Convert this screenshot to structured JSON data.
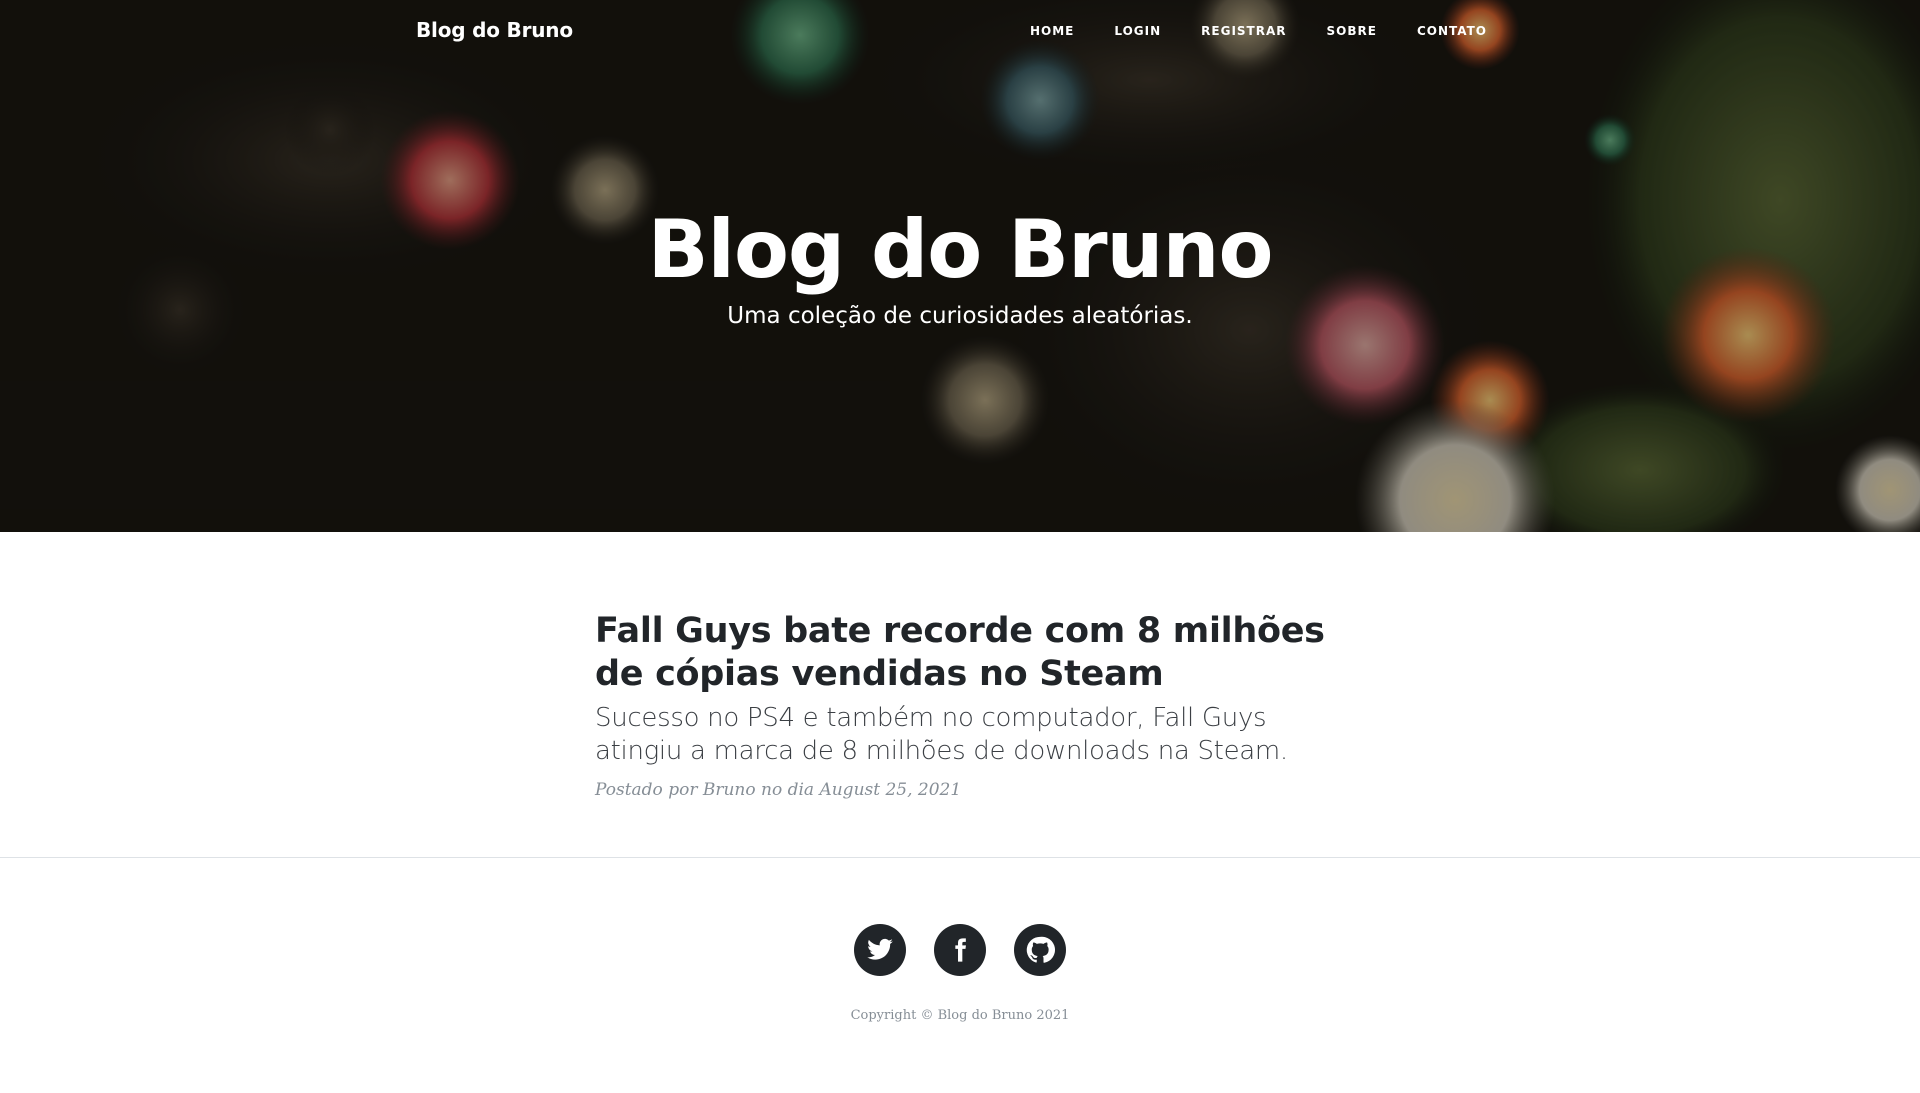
{
  "navbar": {
    "brand": "Blog do Bruno",
    "links": [
      "HOME",
      "LOGIN",
      "REGISTRAR",
      "SOBRE",
      "CONTATO"
    ]
  },
  "hero": {
    "title": "Blog do Bruno",
    "subtitle": "Uma coleção de curiosidades aleatórias."
  },
  "post": {
    "title": "Fall Guys bate recorde com 8 milhões de cópias vendidas no Steam",
    "subtitle": "Sucesso no PS4 e também no computador, Fall Guys atingiu a marca de 8 milhões de downloads na Steam.",
    "meta_prefix": "Postado por ",
    "author": "Bruno",
    "meta_date": " no dia August 25, 2021"
  },
  "footer": {
    "socials": [
      "twitter-icon",
      "facebook-icon",
      "github-icon"
    ],
    "copyright": "Copyright © Blog do Bruno 2021"
  },
  "colors": {
    "text": "#212529",
    "muted": "#868e96",
    "social_bg": "#212529"
  }
}
